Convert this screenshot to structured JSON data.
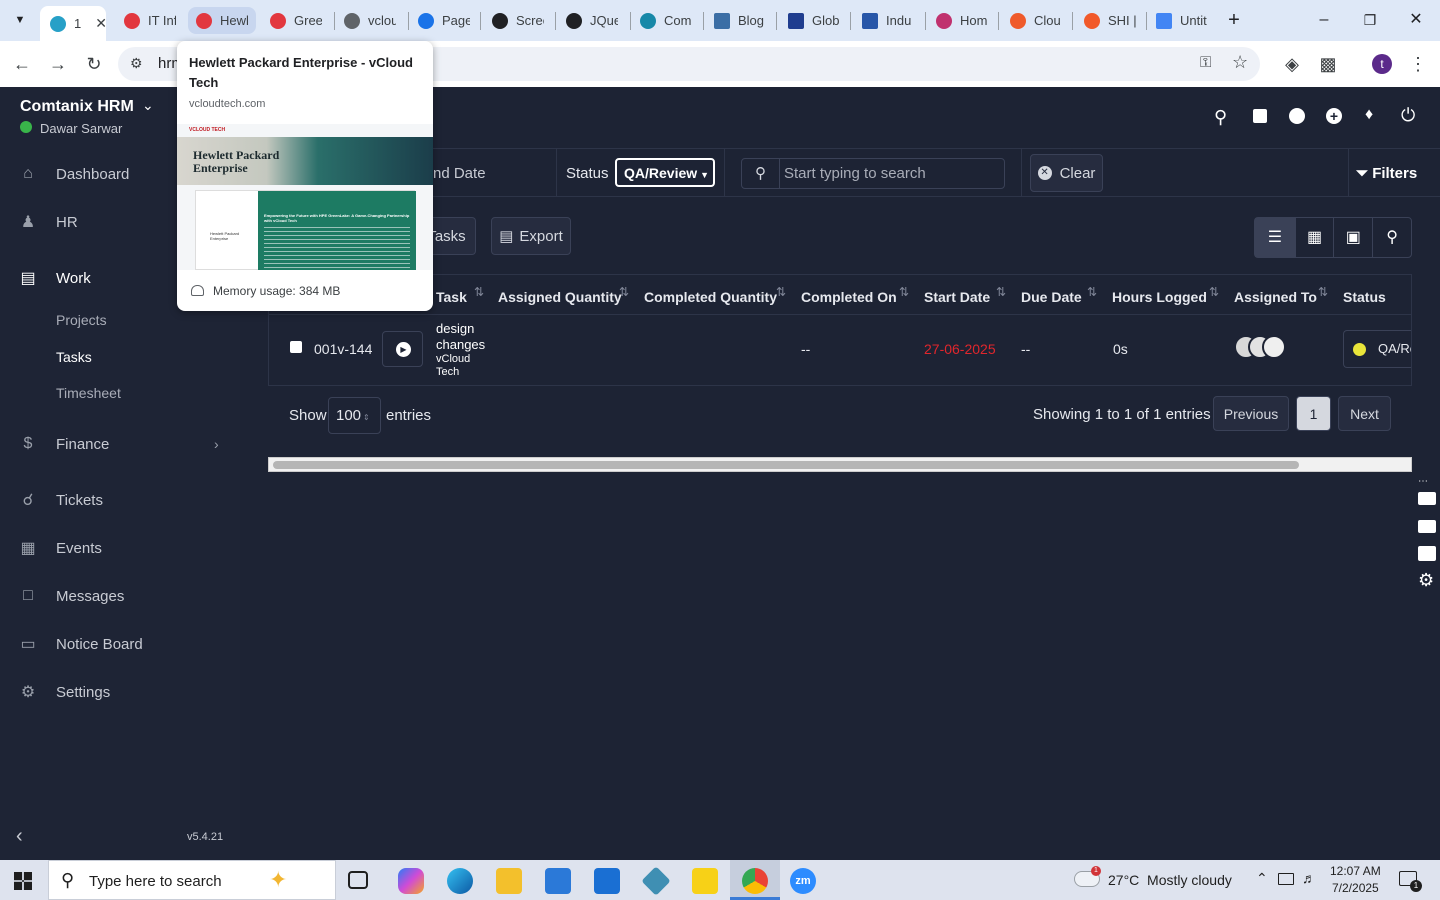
{
  "browser": {
    "tabs": [
      {
        "label": "1",
        "active": true
      },
      {
        "label": "IT Inf"
      },
      {
        "label": "Hewl",
        "highlighted": true
      },
      {
        "label": "Gree"
      },
      {
        "label": "vclou"
      },
      {
        "label": "Page"
      },
      {
        "label": "Scree"
      },
      {
        "label": "JQue"
      },
      {
        "label": "Com"
      },
      {
        "label": "Blog"
      },
      {
        "label": "Glob"
      },
      {
        "label": "Indu"
      },
      {
        "label": "Hom"
      },
      {
        "label": "Clou"
      },
      {
        "label": "SHI |"
      },
      {
        "label": "Untit"
      }
    ],
    "address_partial": "hrm",
    "profile_initial": "t"
  },
  "tab_popup": {
    "title": "Hewlett Packard Enterprise - vCloud Tech",
    "domain": "vcloudtech.com",
    "preview_logo": "VCLOUD TECH",
    "preview_heading": "Hewlett Packard Enterprise",
    "preview_card_title": "Empowering the Future with HPE GreenLake: A Game-Changing Partnership with vCloud Tech",
    "preview_card_logo": "Hewlett Packard Enterprise",
    "memory": "Memory usage: 384 MB"
  },
  "sidebar": {
    "company": "Comtanix HRM",
    "user": "Dawar Sarwar",
    "items": [
      {
        "label": "Dashboard",
        "icon": "home-icon"
      },
      {
        "label": "HR",
        "icon": "users-icon"
      },
      {
        "label": "Work",
        "icon": "briefcase-icon"
      },
      {
        "label": "Finance",
        "icon": "dollar-icon"
      },
      {
        "label": "Tickets",
        "icon": "headset-icon"
      },
      {
        "label": "Events",
        "icon": "calendar-icon"
      },
      {
        "label": "Messages",
        "icon": "message-icon"
      },
      {
        "label": "Notice Board",
        "icon": "clipboard-icon"
      },
      {
        "label": "Settings",
        "icon": "gear-icon"
      }
    ],
    "work_sub": [
      "Projects",
      "Tasks",
      "Timesheet"
    ],
    "version": "v5.4.21"
  },
  "filters": {
    "date_label": "nd Date",
    "status_label": "Status",
    "status_value": "QA/Review",
    "search_placeholder": "Start typing to search",
    "clear": "Clear",
    "filters": "Filters"
  },
  "actions": {
    "tasks": "Tasks",
    "export": "Export"
  },
  "table": {
    "columns": [
      "Task",
      "Assigned Quantity",
      "Completed Quantity",
      "Completed On",
      "Start Date",
      "Due Date",
      "Hours Logged",
      "Assigned To",
      "Status"
    ],
    "row": {
      "code": "001v-144",
      "task_line1": "design",
      "task_line2": "changes",
      "project_line1": "vCloud",
      "project_line2": "Tech",
      "completed_on": "--",
      "start_date": "27-06-2025",
      "due_date": "--",
      "hours": "0s",
      "status": "QA/Re"
    },
    "show": "Show",
    "entries_value": "100",
    "entries": "entries",
    "summary": "Showing 1 to 1 of 1 entries",
    "prev": "Previous",
    "page": "1",
    "next": "Next"
  },
  "taskbar": {
    "search_placeholder": "Type here to search",
    "weather": "27°C  Mostly cloudy",
    "weather_badge": "1",
    "time": "12:07 AM",
    "date": "7/2/2025",
    "notif_count": "1"
  },
  "colors": {
    "accent": "#1d2334",
    "start_date": "#e0262c",
    "status_dot": "#e9e53a"
  }
}
